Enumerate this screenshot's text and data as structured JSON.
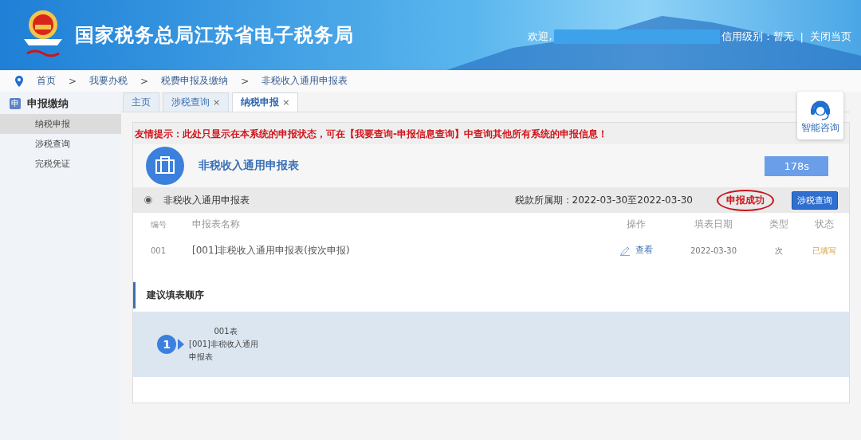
{
  "header": {
    "title": "国家税务总局江苏省电子税务局",
    "welcome": "欢迎,",
    "credit": "信用级别：暂无",
    "separator": "|",
    "close_link": "关闭当页"
  },
  "breadcrumb": [
    "首页",
    "我要办税",
    "税费申报及缴纳",
    "非税收入通用申报表"
  ],
  "breadcrumb_separator": ">",
  "sidebar": {
    "icon_text": "申",
    "title": "申报缴纳",
    "items": [
      {
        "label": "纳税申报",
        "selected": true
      },
      {
        "label": "涉税查询",
        "selected": false
      },
      {
        "label": "完税凭证",
        "selected": false
      }
    ]
  },
  "tabs": [
    {
      "label": "主页",
      "selected": false,
      "closable": false
    },
    {
      "label": "涉税查询",
      "selected": false,
      "closable": true
    },
    {
      "label": "纳税申报",
      "selected": true,
      "closable": true
    }
  ],
  "tab_close": "×",
  "help_widget": {
    "label": "智能咨询"
  },
  "notice": "友情提示：此处只显示在本系统的申报状态，可在【我要查询-申报信息查询】中查询其他所有系统的申报信息！",
  "form_header": {
    "title": "非税收入通用申报表",
    "timer": "178s"
  },
  "group": {
    "name": "非税收入通用申报表",
    "selected": true,
    "period": "税款所属期：2022-03-30至2022-03-30",
    "status": "申报成功",
    "status_circled": true,
    "query_button": "涉税查询"
  },
  "table": {
    "columns": [
      "编号",
      "申报表名称",
      "操作",
      "填表日期",
      "类型",
      "状态"
    ],
    "rows": [
      {
        "number": "001",
        "name": "[001]非税收入通用申报表(按次申报)",
        "action": "查看",
        "date": "2022-03-30",
        "type": "次",
        "status": "已填写"
      }
    ]
  },
  "order": {
    "title": "建议填表顺序",
    "steps": [
      {
        "index": "1",
        "code": "001表",
        "name": "[001]非税收入通用申报表"
      }
    ]
  }
}
